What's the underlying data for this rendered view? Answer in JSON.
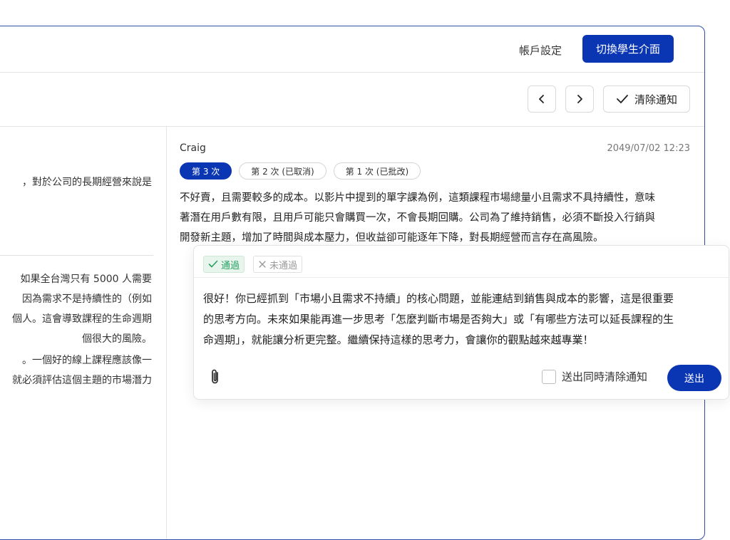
{
  "header": {
    "account_settings": "帳戶設定",
    "switch_student": "切換學生介面"
  },
  "toolbar": {
    "clear_label": "清除通知"
  },
  "left_pane": {
    "snippet_1": "，對於公司的長期經營來說是",
    "snippet_2": [
      " 如果全台灣只有 5000 人需要",
      "因為需求不是持續性的（例如",
      "個人。這會導致課程的生命週期",
      "個很大的風險。"
    ],
    "snippet_3": [
      "。一個好的線上課程應該像一",
      "就必須評估這個主題的市場潛力"
    ]
  },
  "submission": {
    "student": "Craig",
    "timestamp": "2049/07/02 12:23",
    "tabs": [
      {
        "label": "第 3 次",
        "active": true
      },
      {
        "label": "第 2 次 (已取消)",
        "active": false
      },
      {
        "label": "第 1 次 (已批改)",
        "active": false
      }
    ],
    "answer_lines": [
      "不好賣，且需要較多的成本。以影片中提到的單字課為例，這類課程市場總量小且需求不具持續性，意味",
      "著潛在用戶數有限，且用戶可能只會購買一次，不會長期回購。公司為了維持銷售，必須不斷投入行銷與",
      "開發新主題，增加了時間與成本壓力，但收益卻可能逐年下降，對長期經營而言存在高風險。"
    ]
  },
  "review": {
    "pass_label": "通過",
    "fail_label": "未通過",
    "feedback_lines": [
      "很好！你已經抓到「市場小且需求不持續」的核心問題，並能連結到銷售與成本的影響，這是很重要",
      "的思考方向。未來如果能再進一步思考「怎麼判斷市場是否夠大」或「有哪些方法可以延長課程的生",
      "命週期」，就能讓分析更完整。繼續保持這樣的思考力，會讓你的觀點越來越專業！"
    ],
    "clear_on_send_label": "送出同時清除通知",
    "send_label": "送出",
    "accent_color": "#0a36b4",
    "pass_color": "#27a060"
  }
}
